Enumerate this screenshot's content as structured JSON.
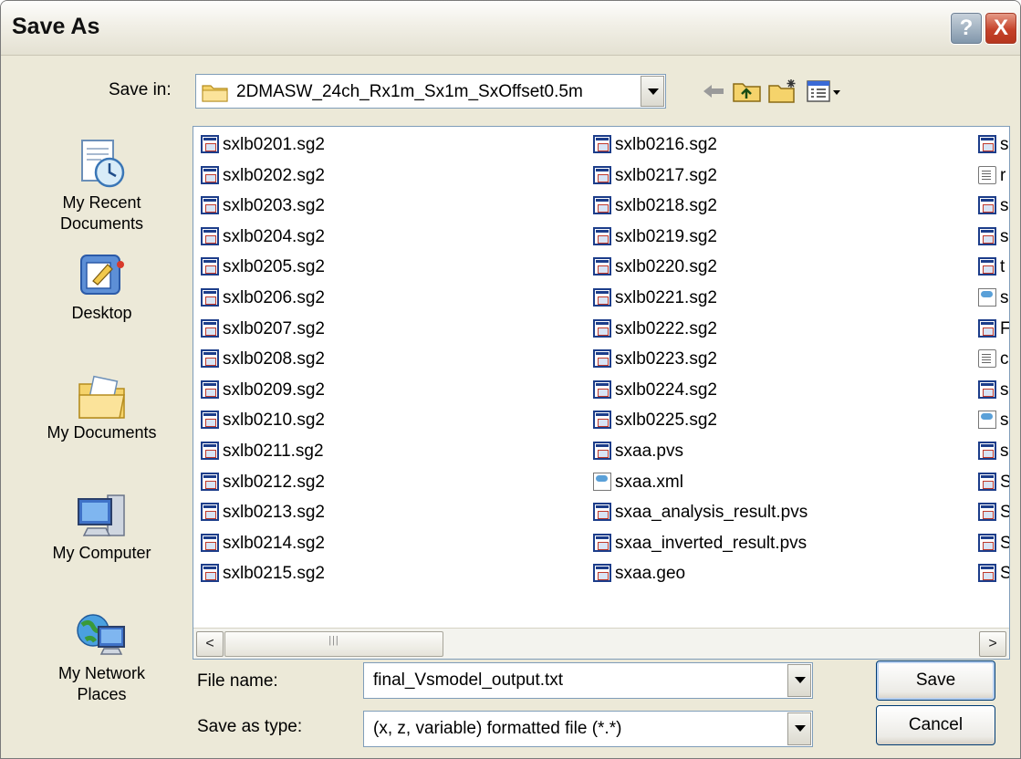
{
  "window": {
    "title": "Save As",
    "help_label": "?",
    "close_label": "X"
  },
  "save_in": {
    "label": "Save in:",
    "value": "2DMASW_24ch_Rx1m_Sx1m_SxOffset0.5m"
  },
  "toolbar": {
    "back_icon": "back-arrow-icon",
    "up_icon": "up-folder-icon",
    "new_folder_icon": "new-folder-icon",
    "views_icon": "views-menu-icon"
  },
  "places": [
    {
      "label": "My Recent\nDocuments",
      "icon": "recent-documents-icon"
    },
    {
      "label": "Desktop",
      "icon": "desktop-icon"
    },
    {
      "label": "My Documents",
      "icon": "my-documents-icon"
    },
    {
      "label": "My Computer",
      "icon": "my-computer-icon"
    },
    {
      "label": "My Network\nPlaces",
      "icon": "network-places-icon"
    }
  ],
  "files_col1": [
    "sxlb0201.sg2",
    "sxlb0202.sg2",
    "sxlb0203.sg2",
    "sxlb0204.sg2",
    "sxlb0205.sg2",
    "sxlb0206.sg2",
    "sxlb0207.sg2",
    "sxlb0208.sg2",
    "sxlb0209.sg2",
    "sxlb0210.sg2",
    "sxlb0211.sg2",
    "sxlb0212.sg2",
    "sxlb0213.sg2",
    "sxlb0214.sg2",
    "sxlb0215.sg2"
  ],
  "files_col2": [
    "sxlb0216.sg2",
    "sxlb0217.sg2",
    "sxlb0218.sg2",
    "sxlb0219.sg2",
    "sxlb0220.sg2",
    "sxlb0221.sg2",
    "sxlb0222.sg2",
    "sxlb0223.sg2",
    "sxlb0224.sg2",
    "sxlb0225.sg2",
    "sxaa.pvs",
    "sxaa.xml",
    "sxaa_analysis_result.pvs",
    "sxaa_inverted_result.pvs",
    "sxaa.geo"
  ],
  "files_col3": [
    "s",
    "r",
    "s",
    "s",
    "t",
    "s",
    "F",
    "c",
    "s",
    "s",
    "s",
    "S",
    "S",
    "S",
    "S"
  ],
  "files_col3_icons": [
    "sg",
    "txt",
    "sg",
    "sg",
    "sg",
    "xml",
    "sg",
    "txt",
    "sg",
    "xml",
    "sg",
    "sg",
    "sg",
    "sg",
    "sg"
  ],
  "scrollbar": {
    "left_label": "<",
    "right_label": ">"
  },
  "file_name": {
    "label": "File name:",
    "value": "final_Vsmodel_output.txt"
  },
  "file_type": {
    "label": "Save as type:",
    "value": "(x, z, variable) formatted file (*.*)"
  },
  "buttons": {
    "save": "Save",
    "cancel": "Cancel"
  }
}
